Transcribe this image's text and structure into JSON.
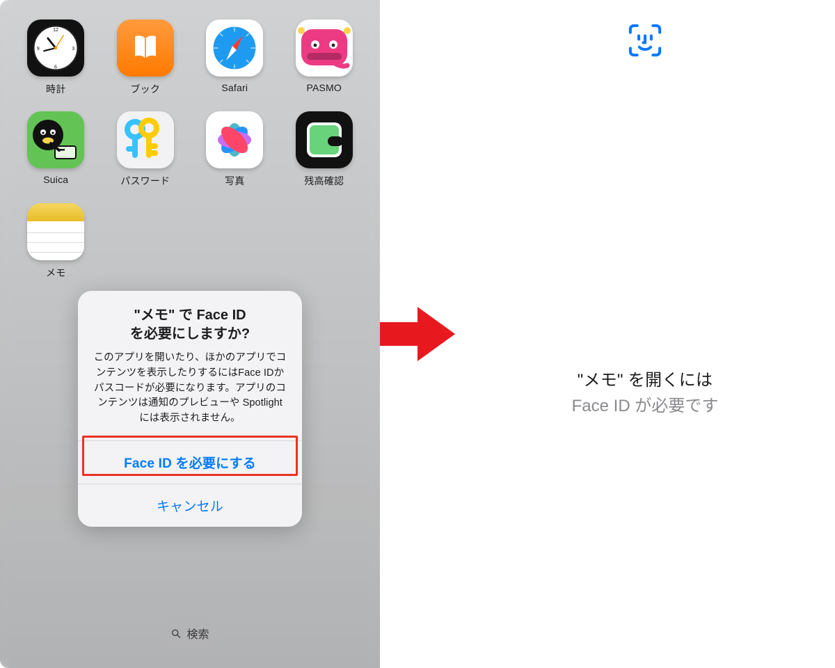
{
  "apps": [
    {
      "id": "clock",
      "label": "時計"
    },
    {
      "id": "books",
      "label": "ブック"
    },
    {
      "id": "safari",
      "label": "Safari"
    },
    {
      "id": "pasmo",
      "label": "PASMO"
    },
    {
      "id": "suica",
      "label": "Suica"
    },
    {
      "id": "passwords",
      "label": "パスワード"
    },
    {
      "id": "photos",
      "label": "写真"
    },
    {
      "id": "balance",
      "label": "残高確認"
    },
    {
      "id": "notes",
      "label": "メモ"
    }
  ],
  "dialog": {
    "title_line1": "\"メモ\" で Face ID",
    "title_line2": "を必要にしますか?",
    "body": "このアプリを開いたり、ほかのアプリでコンテンツを表示したりするにはFace IDかパスコードが必要になります。アプリのコンテンツは通知のプレビューや Spotlightには表示されません。",
    "primary": "Face ID を必要にする",
    "cancel": "キャンセル"
  },
  "search_label": "検索",
  "right": {
    "line1": "\"メモ\" を開くには",
    "line2": "Face ID が必要です"
  }
}
